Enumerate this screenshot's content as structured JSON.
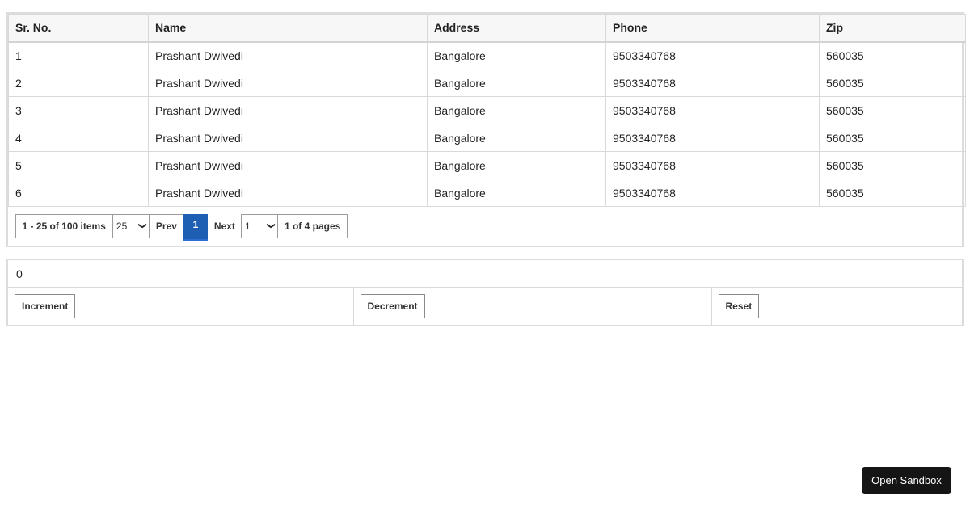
{
  "table": {
    "columns": [
      "Sr. No.",
      "Name",
      "Address",
      "Phone",
      "Zip"
    ],
    "rows": [
      [
        "1",
        "Prashant Dwivedi",
        "Bangalore",
        "9503340768",
        "560035"
      ],
      [
        "2",
        "Prashant Dwivedi",
        "Bangalore",
        "9503340768",
        "560035"
      ],
      [
        "3",
        "Prashant Dwivedi",
        "Bangalore",
        "9503340768",
        "560035"
      ],
      [
        "4",
        "Prashant Dwivedi",
        "Bangalore",
        "9503340768",
        "560035"
      ],
      [
        "5",
        "Prashant Dwivedi",
        "Bangalore",
        "9503340768",
        "560035"
      ],
      [
        "6",
        "Prashant Dwivedi",
        "Bangalore",
        "9503340768",
        "560035"
      ]
    ]
  },
  "pager": {
    "items_info": "1 - 25 of 100 items",
    "page_size": "25",
    "prev_label": "Prev",
    "current_page": "1",
    "next_label": "Next",
    "page_select": "1",
    "pages_info": "1 of 4 pages",
    "active_color": "#1e5fb4"
  },
  "counter": {
    "value": "0",
    "increment_label": "Increment",
    "decrement_label": "Decrement",
    "reset_label": "Reset"
  },
  "sandbox": {
    "label": "Open Sandbox"
  }
}
